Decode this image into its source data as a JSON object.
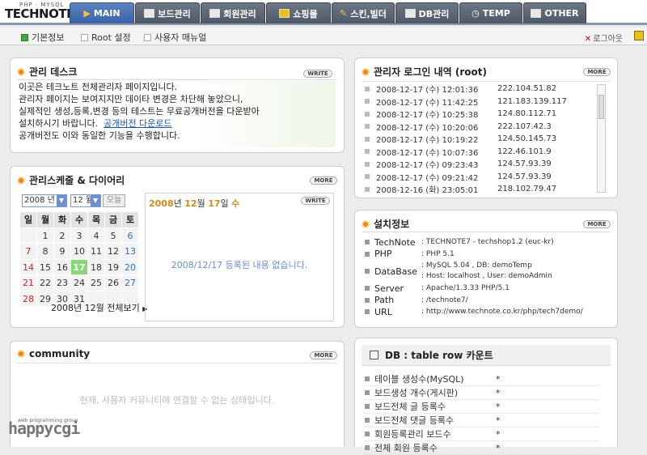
{
  "logo": {
    "sub": "PHP · MYSQL",
    "main": "TECHNOTE"
  },
  "tabs": [
    {
      "label": "MAIN",
      "icon": "play-icon",
      "active": true
    },
    {
      "label": "보드관리",
      "icon": "board-icon"
    },
    {
      "label": "회원관리",
      "icon": "member-icon"
    },
    {
      "label": "쇼핑몰",
      "icon": "shop-icon"
    },
    {
      "label": "스킨,빌더",
      "icon": "tools-icon"
    },
    {
      "label": "DB관리",
      "icon": "database-icon"
    },
    {
      "label": "TEMP",
      "icon": "clock-icon"
    },
    {
      "label": "OTHER",
      "icon": "other-icon"
    }
  ],
  "subnav": {
    "items": [
      "기본정보",
      "Root 설정",
      "사용자 매뉴얼"
    ],
    "logout": "로그아웃"
  },
  "desk": {
    "title": "관리 데스크",
    "write": "WRITE",
    "lines": [
      "이곳은 테크노트 전체관리자 페이지입니다.",
      "관리자 페이지는 보여지지만 데이타 변경은 차단해 놓았으니,",
      "실제적인 생성,등록,변경 등의 테스트는 무료공개버전을 다운받아"
    ],
    "line4": "설치하시기 바랍니다.",
    "link": "공개버전 다운로드",
    "line5": "공개버전도 이와 동일한 기능을 수행합니다."
  },
  "login": {
    "title": "관리자 로그인 내역 (root)",
    "more": "MORE",
    "rows": [
      [
        "2008-12-17 (수) 12:01:36",
        "222.104.51.82"
      ],
      [
        "2008-12-17 (수) 11:42:25",
        "121.183.139.117"
      ],
      [
        "2008-12-17 (수) 10:25:38",
        "124.80.112.71"
      ],
      [
        "2008-12-17 (수) 10:20:06",
        "222.107.42.3"
      ],
      [
        "2008-12-17 (수) 10:19:22",
        "124.50.145.73"
      ],
      [
        "2008-12-17 (수) 10:07:36",
        "122.46.101.9"
      ],
      [
        "2008-12-17 (수) 09:23:43",
        "124.57.93.39"
      ],
      [
        "2008-12-17 (수) 09:21:42",
        "124.57.93.39"
      ],
      [
        "2008-12-16 (화) 23:05:01",
        "218.102.79.47"
      ]
    ]
  },
  "schedule": {
    "title": "관리스케줄 & 다이어리",
    "more": "MORE",
    "year": "2008 년",
    "month": "12 월",
    "today_btn": "오늘",
    "weekdays": [
      "일",
      "월",
      "화",
      "수",
      "목",
      "금",
      "토"
    ],
    "weeks": [
      [
        "",
        "1",
        "2",
        "3",
        "4",
        "5",
        "6"
      ],
      [
        "7",
        "8",
        "9",
        "10",
        "11",
        "12",
        "13"
      ],
      [
        "14",
        "15",
        "16",
        "17",
        "18",
        "19",
        "20"
      ],
      [
        "21",
        "22",
        "23",
        "24",
        "25",
        "26",
        "27"
      ],
      [
        "28",
        "29",
        "30",
        "31",
        "",
        "",
        ""
      ]
    ],
    "today": "17",
    "view_all": "2008년 12월 전체보기",
    "date_y": "2008",
    "date_m": "12",
    "date_d": "17",
    "date_w": "수",
    "write": "WRITE",
    "empty": "2008/12/17 등록된 내용 없습니다."
  },
  "install": {
    "title": "설치정보",
    "more": "MORE",
    "rows": [
      {
        "k": "TechNote",
        "v": ": TECHNOTE7 - techshop1.2 (euc-kr)"
      },
      {
        "k": "PHP",
        "v": ": PHP 5.1"
      },
      {
        "k": "DataBase",
        "v": ": MySQL 5.04 , DB: demoTemp",
        "v2": ": Host: localhost , User: demoAdmin"
      },
      {
        "k": "Server",
        "v": ": Apache/1.3.33  PHP/5.1"
      },
      {
        "k": "Path",
        "v": ":   /technote7/"
      },
      {
        "k": "URL",
        "v": ": http://www.technote.co.kr/php/tech7demo/"
      }
    ]
  },
  "community": {
    "title": "community",
    "more": "MORE",
    "empty": "현재, 사용자 커뮤니티에 연결할 수 없는 상태입니다."
  },
  "db": {
    "title": "DB : table row 카운트",
    "rows": [
      [
        "테이블 생성수(MySQL)",
        "*"
      ],
      [
        "보드생성 개수(게시판)",
        "*"
      ],
      [
        "보드전체 글 등록수",
        "*"
      ],
      [
        "보드전체 댓글 등록수",
        "*"
      ],
      [
        "회원등록관리 보드수",
        "*"
      ],
      [
        "전체 회원 등록수",
        "*"
      ]
    ]
  },
  "footer": {
    "brand": "happycgi",
    "sub": "web programming group"
  },
  "colors": {
    "tab": "#56606f",
    "tab_active": "#3f69ae",
    "accent": "#e88a18",
    "today": "#8ad47a"
  }
}
